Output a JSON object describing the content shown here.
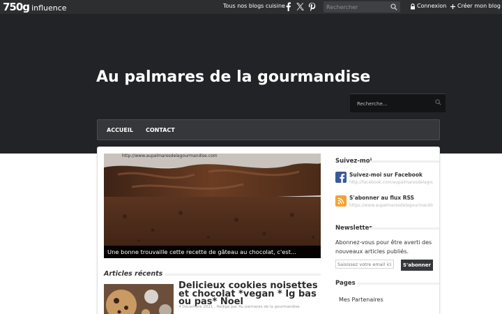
{
  "topbar": {
    "logo_number": "750g",
    "logo_word": "influence",
    "all_blogs_link": "Tous nos blogs cuisine",
    "social_icons": [
      "facebook-icon",
      "x-icon",
      "pinterest-icon"
    ],
    "search_placeholder": "Rechercher",
    "login_icon": "lock-icon",
    "login_label": "Connexion",
    "create_icon": "plus-icon",
    "create_label": "Créer mon blog",
    "colors": {
      "bar": "#2d2e30",
      "text": "#ffffff"
    }
  },
  "header": {
    "blog_title": "Au palmares de la gourmandise",
    "search_placeholder": "Recherche...",
    "colors": {
      "background": "#222326"
    }
  },
  "nav": {
    "items": [
      {
        "label": "ACCUEIL"
      },
      {
        "label": "CONTACT"
      }
    ]
  },
  "main": {
    "feature": {
      "overlay_url": "http://www.aupalmaresdelagourmandise.com",
      "caption": "Une bonne trouvaille cette recette de gâteau au chocolat, c'est..."
    },
    "recent_title": "Articles récents",
    "posts": [
      {
        "title": "Delicieux cookies noisettes et chocolat *vegan * Ig bas ou pas* Noel",
        "meta": "4 Décembre 2021 , Rédigé par Au palmares de la gourmandise"
      }
    ]
  },
  "sidebar": {
    "follow_title": "Suivez-moi",
    "follow_items": [
      {
        "icon": "facebook-icon",
        "label": "Suivez-moi sur Facebook",
        "url": "http://facebook.com/aupalmaresdelagourmandise",
        "color": "#3b5998"
      },
      {
        "icon": "rss-icon",
        "label": "S'abonner au flux RSS",
        "url": "https://www.aupalmaresdelagourmandise.com/rss",
        "color": "#f7a131"
      }
    ],
    "newsletter_title": "Newsletter",
    "newsletter_text": "Abonnez-vous pour être averti des nouveaux articles publiés.",
    "newsletter_placeholder": "Saisissez votre email ici",
    "newsletter_button": "S'abonner",
    "pages_title": "Pages",
    "pages": [
      "Mes Partenaires"
    ]
  }
}
